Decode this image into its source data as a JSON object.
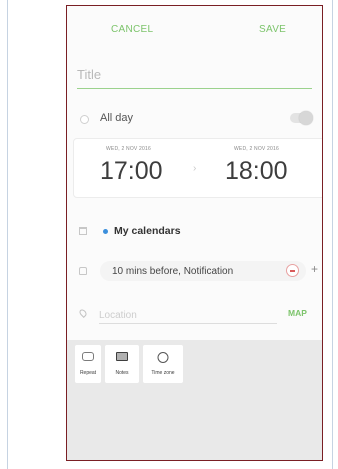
{
  "header": {
    "cancel_label": "CANCEL",
    "save_label": "SAVE"
  },
  "title_field": {
    "placeholder": "Title",
    "value": ""
  },
  "all_day": {
    "label": "All day",
    "enabled": false
  },
  "start": {
    "date": "WED, 2 NOV 2016",
    "time": "17:00"
  },
  "end": {
    "date": "WED, 2 NOV 2016",
    "time": "18:00"
  },
  "calendar": {
    "label": "My calendars",
    "dot_color": "#3b8fdc"
  },
  "reminder": {
    "text": "10 mins before, Notification",
    "add_label": "+"
  },
  "location": {
    "placeholder": "Location",
    "value": "",
    "map_label": "MAP"
  },
  "options": [
    {
      "label": "Repeat",
      "icon": "repeat-icon"
    },
    {
      "label": "Notes",
      "icon": "notes-icon"
    },
    {
      "label": "Time zone",
      "icon": "time-zone-icon"
    }
  ],
  "colors": {
    "accent": "#7cc46b",
    "frame_border": "#7a1f24",
    "remove": "#d95b5b"
  }
}
